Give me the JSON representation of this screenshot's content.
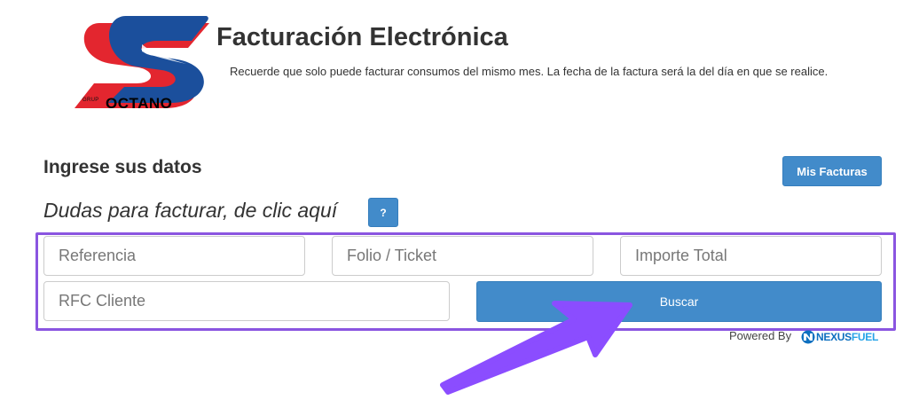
{
  "header": {
    "logo": {
      "icon": "octano-s-logo-icon",
      "small_text": "GRUP",
      "word": "OCTANO",
      "colors": {
        "red": "#e3262f",
        "blue": "#1b4f9c"
      }
    },
    "title": "Facturación Electrónica",
    "notice": "Recuerde que solo puede facturar consumos del mismo mes. La fecha de la factura será la del día en que se realice."
  },
  "section": {
    "title": "Ingrese sus datos",
    "help_text": "Dudas para facturar, de clic aquí",
    "help_button": "?",
    "invoices_button": "Mis Facturas"
  },
  "form": {
    "reference_placeholder": "Referencia",
    "folio_placeholder": "Folio / Ticket",
    "total_placeholder": "Importe Total",
    "rfc_placeholder": "RFC Cliente",
    "search_button": "Buscar"
  },
  "footer": {
    "powered_by": "Powered By",
    "brand_a": "NEXUS",
    "brand_b": "FUEL",
    "brand_icon": "nexusfuel-logo-icon"
  },
  "annotation": {
    "arrow_icon": "arrow-pointer-icon",
    "frame_color": "#8a55e0"
  },
  "colors": {
    "primary_button": "#428bca",
    "text": "#333333"
  }
}
